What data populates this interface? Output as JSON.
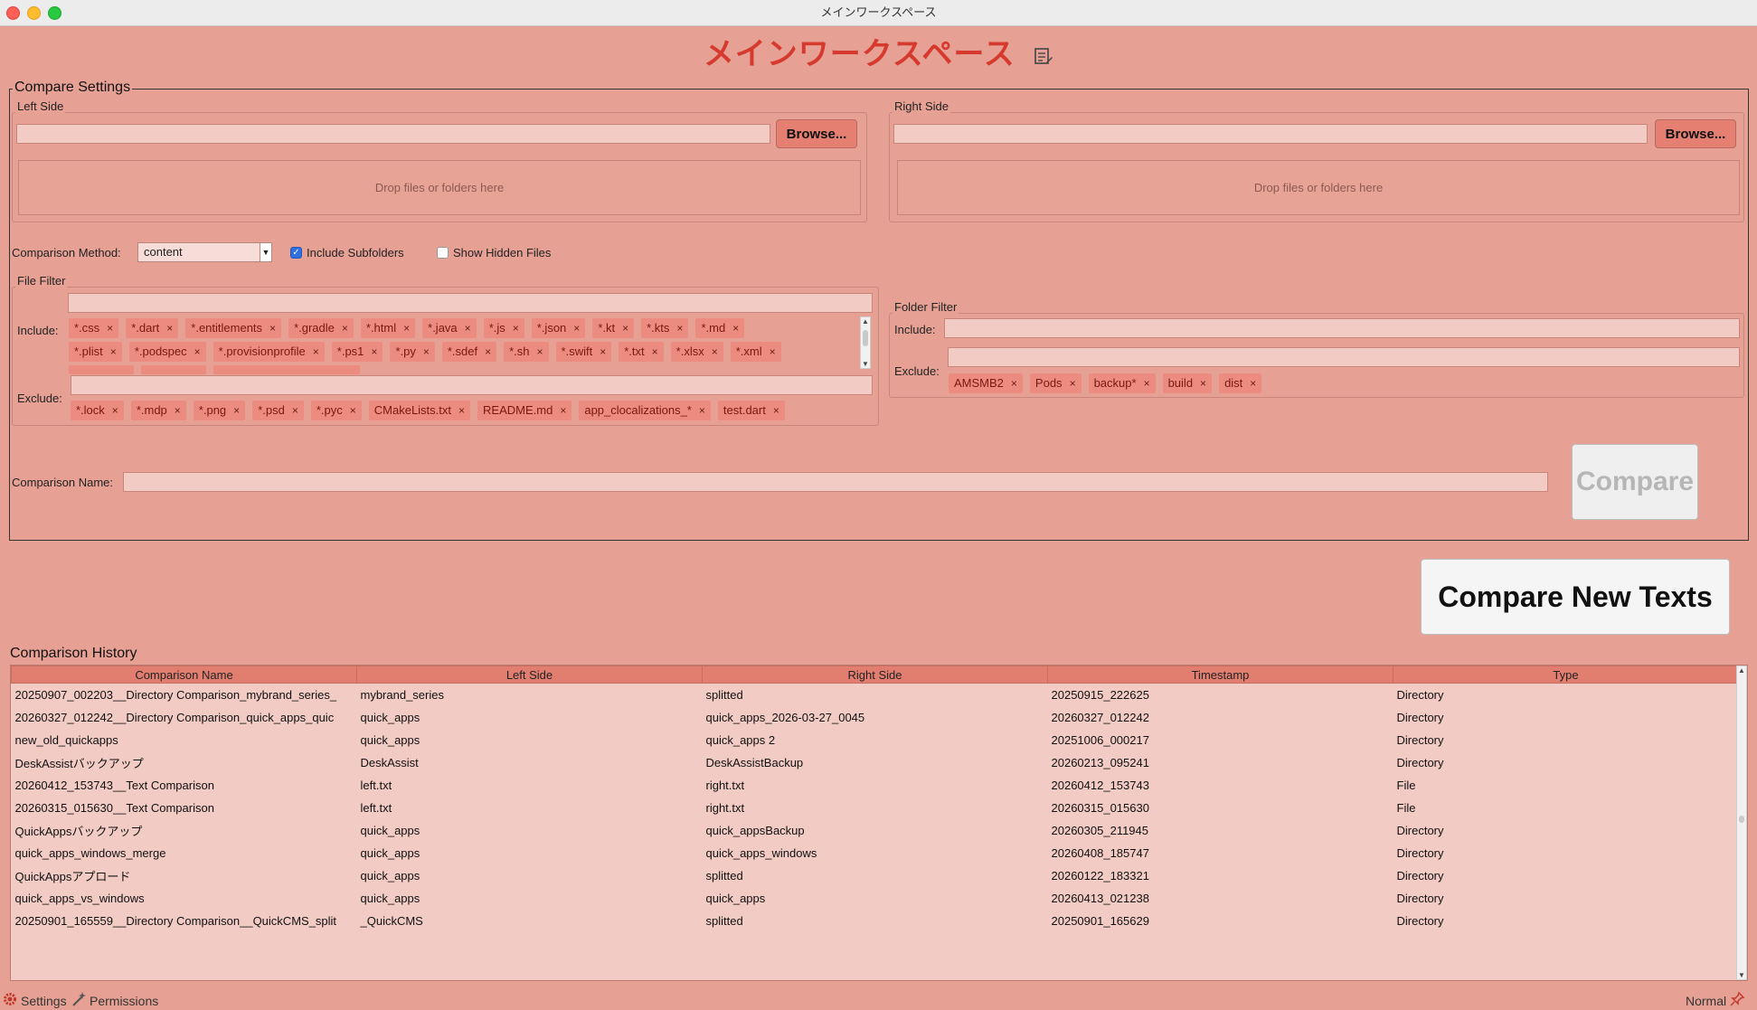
{
  "window": {
    "title": "メインワークスペース"
  },
  "heading": {
    "title": "メインワークスペース"
  },
  "compare_settings": {
    "legend": "Compare Settings",
    "left_side": {
      "label": "Left Side",
      "path_value": "",
      "browse_label": "Browse...",
      "drop_text": "Drop files or folders here"
    },
    "right_side": {
      "label": "Right Side",
      "path_value": "",
      "browse_label": "Browse...",
      "drop_text": "Drop files or folders here"
    },
    "comparison_method": {
      "label": "Comparison Method:",
      "selected": "content"
    },
    "include_subfolders": {
      "label": "Include Subfolders",
      "checked": true
    },
    "show_hidden_files": {
      "label": "Show Hidden Files",
      "checked": false
    },
    "file_filter": {
      "label": "File Filter",
      "include_label": "Include:",
      "include_tags_row1": [
        "*.css",
        "*.dart",
        "*.entitlements",
        "*.gradle",
        "*.html",
        "*.java",
        "*.js",
        "*.json",
        "*.kt",
        "*.kts",
        "*.md"
      ],
      "include_tags_row2": [
        "*.plist",
        "*.podspec",
        "*.provisionprofile",
        "*.ps1",
        "*.py",
        "*.sdef",
        "*.sh",
        "*.swift",
        "*.txt",
        "*.xlsx",
        "*.xml"
      ],
      "exclude_label": "Exclude:",
      "exclude_tags": [
        "*.lock",
        "*.mdp",
        "*.png",
        "*.psd",
        "*.pyc",
        "CMakeLists.txt",
        "README.md",
        "app_clocalizations_*",
        "test.dart"
      ]
    },
    "folder_filter": {
      "label": "Folder Filter",
      "include_label": "Include:",
      "exclude_label": "Exclude:",
      "exclude_tags": [
        "AMSMB2",
        "Pods",
        "backup*",
        "build",
        "dist"
      ]
    },
    "comparison_name": {
      "label": "Comparison Name:",
      "value": ""
    },
    "compare_button": "Compare"
  },
  "compare_new_texts_button": "Compare New Texts",
  "history": {
    "title": "Comparison History",
    "columns": [
      "Comparison Name",
      "Left Side",
      "Right Side",
      "Timestamp",
      "Type"
    ],
    "rows": [
      [
        "20250907_002203__Directory Comparison_mybrand_series_",
        "mybrand_series",
        "splitted",
        "20250915_222625",
        "Directory"
      ],
      [
        "20260327_012242__Directory Comparison_quick_apps_quic",
        "quick_apps",
        "quick_apps_2026-03-27_0045",
        "20260327_012242",
        "Directory"
      ],
      [
        "new_old_quickapps",
        "quick_apps",
        "quick_apps 2",
        "20251006_000217",
        "Directory"
      ],
      [
        "DeskAssistバックアップ",
        "DeskAssist",
        "DeskAssistBackup",
        "20260213_095241",
        "Directory"
      ],
      [
        "20260412_153743__Text Comparison",
        "left.txt",
        "right.txt",
        "20260412_153743",
        "File"
      ],
      [
        "20260315_015630__Text Comparison",
        "left.txt",
        "right.txt",
        "20260315_015630",
        "File"
      ],
      [
        "QuickAppsバックアップ",
        "quick_apps",
        "quick_appsBackup",
        "20260305_211945",
        "Directory"
      ],
      [
        "quick_apps_windows_merge",
        "quick_apps",
        "quick_apps_windows",
        "20260408_185747",
        "Directory"
      ],
      [
        "QuickAppsアプロード",
        "quick_apps",
        "splitted",
        "20260122_183321",
        "Directory"
      ],
      [
        "quick_apps_vs_windows",
        "quick_apps",
        "quick_apps",
        "20260413_021238",
        "Directory"
      ],
      [
        "20250901_165559__Directory Comparison__QuickCMS_split",
        "_QuickCMS",
        "splitted",
        "20250901_165629",
        "Directory"
      ]
    ]
  },
  "statusbar": {
    "settings_label": "Settings",
    "permissions_label": "Permissions",
    "mode_label": "Normal"
  },
  "colors": {
    "background": "#e6a194",
    "accent_title": "#d63a2f",
    "tag_bg": "#ec8c80",
    "header_bg": "#e27e70"
  },
  "icons": [
    "edit-note-icon",
    "gear-icon",
    "magic-wand-icon",
    "pin-icon"
  ]
}
